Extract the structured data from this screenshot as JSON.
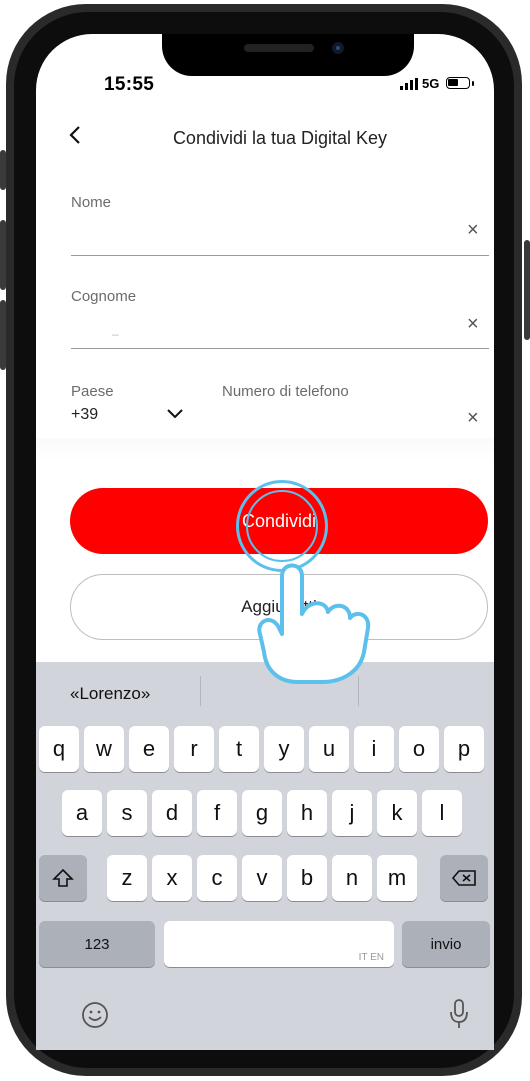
{
  "status_bar": {
    "time": "15:55",
    "network": "5G"
  },
  "header": {
    "back_icon": "chevron-left-icon",
    "title": "Condividi la tua Digital Key"
  },
  "form": {
    "nome_label": "Nome",
    "cognome_label": "Cognome",
    "cognome_value": "_",
    "paese_label": "Paese",
    "paese_value": "+39",
    "telefono_label": "Numero di telefono",
    "clear_glyph": "×"
  },
  "buttons": {
    "share_label": "Condividi",
    "add_contacts_label": "Aggiu    tti"
  },
  "keyboard": {
    "suggestion": "«Lorenzo»",
    "row1": [
      "q",
      "w",
      "e",
      "r",
      "t",
      "y",
      "u",
      "i",
      "o",
      "p"
    ],
    "row2": [
      "a",
      "s",
      "d",
      "f",
      "g",
      "h",
      "j",
      "k",
      "l"
    ],
    "row3": [
      "z",
      "x",
      "c",
      "v",
      "b",
      "n",
      "m"
    ],
    "numbers_label": "123",
    "return_label": "invio",
    "space_tag": "IT EN"
  },
  "colors": {
    "accent": "#ff0000",
    "touch_ring": "#5bc0eb"
  }
}
